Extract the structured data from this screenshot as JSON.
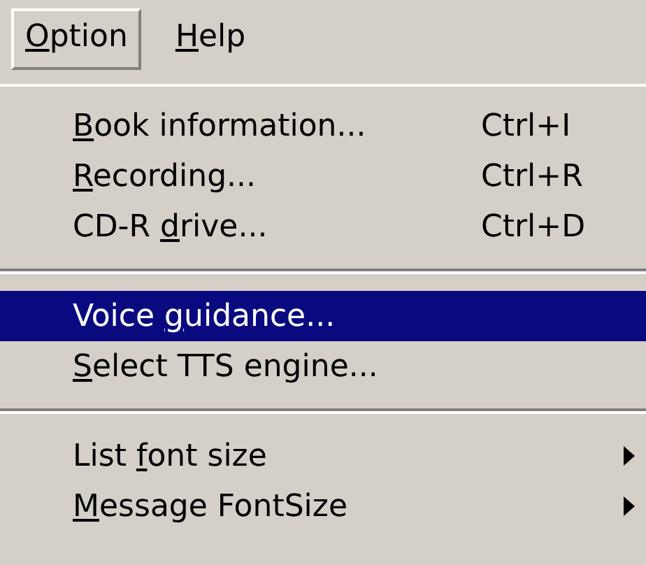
{
  "menu_bar": [
    {
      "label": {
        "key": "O",
        "after": "ption"
      },
      "selected": true
    },
    {
      "label": {
        "key": "H",
        "after": "elp"
      },
      "selected": false
    }
  ],
  "menu": [
    {
      "kind": "item",
      "label": {
        "key": "B",
        "after": "ook information..."
      },
      "shortcut": "Ctrl+I",
      "selected": false
    },
    {
      "kind": "item",
      "label": {
        "key": "R",
        "after": "ecording..."
      },
      "shortcut": "Ctrl+R",
      "selected": false
    },
    {
      "kind": "item",
      "label": {
        "before": "CD-R ",
        "key": "d",
        "after": "rive..."
      },
      "shortcut": "Ctrl+D",
      "selected": false
    },
    {
      "kind": "separator"
    },
    {
      "kind": "item",
      "label": {
        "before": "Voice ",
        "key": "g",
        "after": "uidance..."
      },
      "selected": true
    },
    {
      "kind": "item",
      "label": {
        "key": "S",
        "after": "elect TTS engine..."
      },
      "selected": false
    },
    {
      "kind": "separator"
    },
    {
      "kind": "submenu",
      "label": {
        "before": "List ",
        "key": "f",
        "after": "ont size"
      },
      "selected": false
    },
    {
      "kind": "submenu",
      "label": {
        "key": "M",
        "after": "essage FontSize"
      },
      "selected": false
    }
  ]
}
